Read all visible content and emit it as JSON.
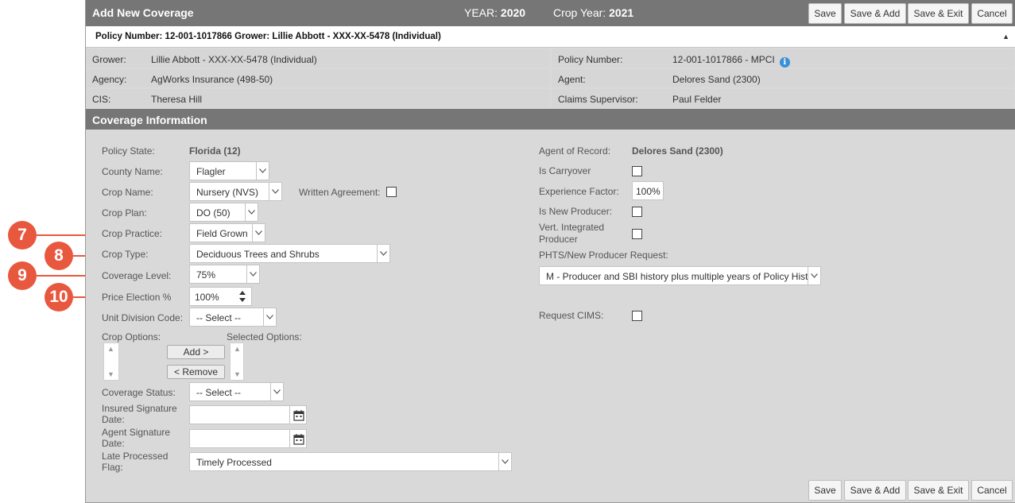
{
  "callouts": [
    "7",
    "8",
    "9",
    "10"
  ],
  "header": {
    "title": "Add New Coverage",
    "year_label": "YEAR:",
    "year_value": "2020",
    "crop_year_label": "Crop Year:",
    "crop_year_value": "2021"
  },
  "actions": {
    "save": "Save",
    "save_add": "Save & Add",
    "save_exit": "Save & Exit",
    "cancel": "Cancel"
  },
  "policy_bar": {
    "text": "Policy Number: 12-001-1017866 Grower: Lillie Abbott - XXX-XX-5478 (Individual)",
    "caret": "▲"
  },
  "info": {
    "grower_label": "Grower:",
    "grower_value": "Lillie Abbott - XXX-XX-5478 (Individual)",
    "policy_number_label": "Policy Number:",
    "policy_number_value": "12-001-1017866 - MPCI",
    "agency_label": "Agency:",
    "agency_value": "AgWorks Insurance (498-50)",
    "agent_label": "Agent:",
    "agent_value": "Delores Sand (2300)",
    "cis_label": "CIS:",
    "cis_value": "Theresa Hill",
    "claims_label": "Claims Supervisor:",
    "claims_value": "Paul Felder",
    "info_icon": "i"
  },
  "section": {
    "title": "Coverage Information"
  },
  "form": {
    "policy_state_label": "Policy State:",
    "policy_state_value": "Florida (12)",
    "county_label": "County Name:",
    "county_value": "Flagler",
    "crop_name_label": "Crop Name:",
    "crop_name_value": "Nursery (NVS)",
    "written_agreement_label": "Written Agreement:",
    "crop_plan_label": "Crop Plan:",
    "crop_plan_value": "DO (50)",
    "crop_practice_label": "Crop Practice:",
    "crop_practice_value": "Field Grown",
    "crop_type_label": "Crop Type:",
    "crop_type_value": "Deciduous Trees and Shrubs",
    "coverage_level_label": "Coverage Level:",
    "coverage_level_value": "75%",
    "price_election_label": "Price Election %",
    "price_election_value": "100%",
    "unit_division_label": "Unit Division Code:",
    "unit_division_value": "-- Select --",
    "crop_options_label": "Crop Options:",
    "selected_options_label": "Selected Options:",
    "add_button": "Add >",
    "remove_button": "< Remove",
    "coverage_status_label": "Coverage Status:",
    "coverage_status_value": "-- Select --",
    "insured_sig_label_1": "Insured Signature",
    "insured_sig_label_2": "Date:",
    "agent_sig_label_1": "Agent Signature",
    "agent_sig_label_2": "Date:",
    "late_flag_label_1": "Late Processed",
    "late_flag_label_2": "Flag:",
    "late_flag_value": "Timely Processed",
    "agent_of_record_label": "Agent of Record:",
    "agent_of_record_value": "Delores Sand (2300)",
    "is_carryover_label": "Is Carryover",
    "experience_factor_label": "Experience Factor:",
    "experience_factor_value": "100%",
    "is_new_producer_label": "Is New Producer:",
    "vert_integrated_label_1": "Vert. Integrated",
    "vert_integrated_label_2": "Producer",
    "phts_label": "PHTS/New Producer Request:",
    "phts_value": "M - Producer and SBI history plus multiple years of Policy History",
    "request_cims_label": "Request CIMS:"
  }
}
